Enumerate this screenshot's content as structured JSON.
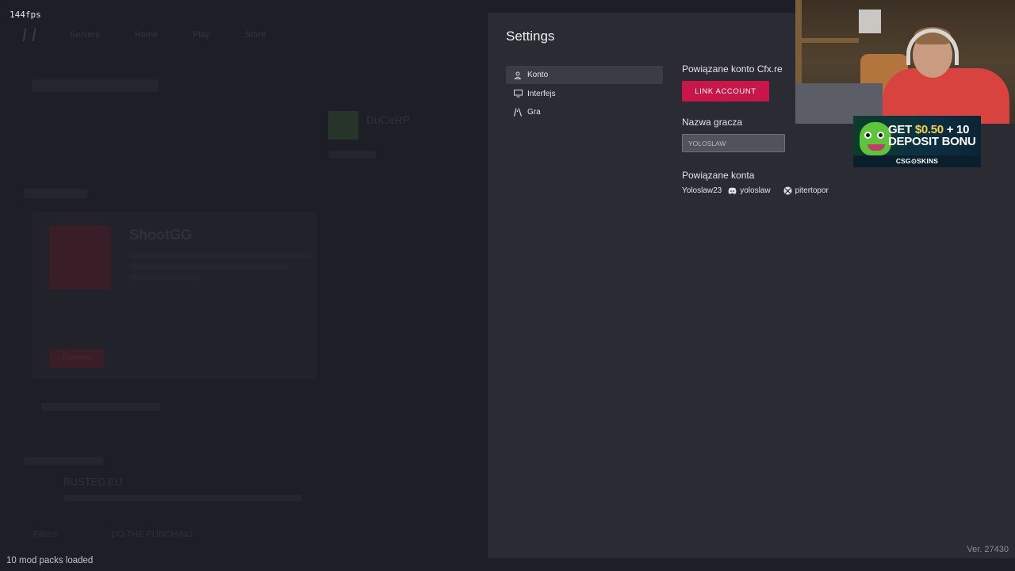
{
  "overlay": {
    "fps": "144fps",
    "status_left": "10 mod packs loaded"
  },
  "background_app": {
    "nav": [
      "Servers",
      "Home",
      "Play",
      "Store"
    ],
    "server_names": [
      "DuCeRP",
      "ShootGG",
      "BUSTED.EU"
    ],
    "footer_links": [
      "Filters",
      "DO THE PUNCHING"
    ],
    "join_label": "Connect"
  },
  "settings": {
    "title": "Settings",
    "menu": [
      {
        "label": "Konto",
        "icon": "user-icon",
        "active": true
      },
      {
        "label": "Interfejs",
        "icon": "monitor-icon",
        "active": false
      },
      {
        "label": "Gra",
        "icon": "game-icon",
        "active": false
      }
    ],
    "linked_account_label": "Powiązane konto Cfx.re",
    "link_button": "LINK ACCOUNT",
    "player_name_label": "Nazwa gracza",
    "player_name_value": "YOLOSLAW",
    "linked_accounts_label": "Powiązane konta",
    "linked_accounts": [
      {
        "name": "Yoloslaw23",
        "icon": "steam-icon"
      },
      {
        "name": "yoloslaw",
        "icon": "discord-icon"
      },
      {
        "name": "pitertopor",
        "icon": "xbox-icon"
      }
    ],
    "version": "Ver. 27430"
  },
  "ad": {
    "line1_prefix": "GET ",
    "line1_amount": "$0.50",
    "line1_suffix": " + 10",
    "line2": "DEPOSIT BONU",
    "brand": "CSG⊙SKINS"
  },
  "colors": {
    "accent": "#c8164a",
    "panel": "#2a2b33",
    "active_menu": "#3b3c45"
  }
}
